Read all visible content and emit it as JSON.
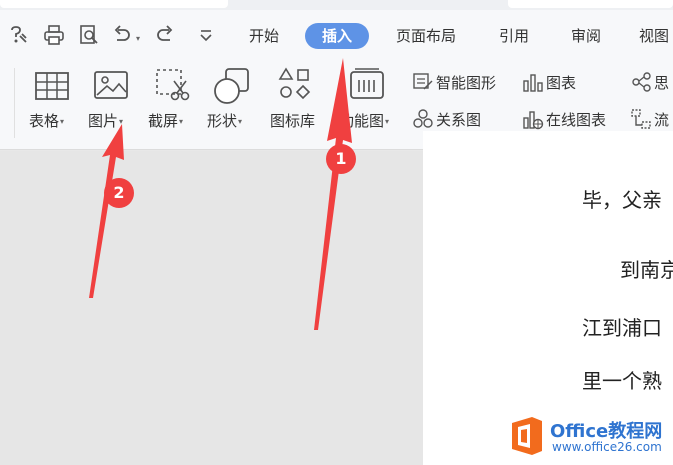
{
  "quick_access": {
    "icons": [
      "format-painter-icon",
      "print-icon",
      "print-preview-icon",
      "undo-icon",
      "redo-icon",
      "customize-dropdown-icon"
    ]
  },
  "menu": {
    "tabs": [
      {
        "label": "开始",
        "active": false
      },
      {
        "label": "插入",
        "active": true
      },
      {
        "label": "页面布局",
        "active": false
      },
      {
        "label": "引用",
        "active": false
      },
      {
        "label": "审阅",
        "active": false
      },
      {
        "label": "视图",
        "active": false
      }
    ]
  },
  "ribbon": {
    "big_buttons": [
      {
        "label": "表格",
        "icon": "table-icon",
        "dropdown": true
      },
      {
        "label": "图片",
        "icon": "picture-icon",
        "dropdown": true
      },
      {
        "label": "截屏",
        "icon": "screenshot-icon",
        "dropdown": true
      },
      {
        "label": "形状",
        "icon": "shapes-icon",
        "dropdown": true
      },
      {
        "label": "图标库",
        "icon": "icon-library-icon",
        "dropdown": false
      },
      {
        "label": "功能图",
        "icon": "function-chart-icon",
        "dropdown": true
      }
    ],
    "small_buttons": [
      {
        "label": "智能图形",
        "icon": "smart-art-icon"
      },
      {
        "label": "图表",
        "icon": "chart-icon"
      },
      {
        "label": "关系图",
        "icon": "relationship-chart-icon"
      },
      {
        "label": "在线图表",
        "icon": "online-chart-icon"
      },
      {
        "label": "思",
        "icon": "mind-map-icon"
      },
      {
        "label": "流",
        "icon": "flowchart-icon"
      }
    ]
  },
  "document": {
    "lines": [
      "毕，父亲",
      "到南京",
      "江到浦口",
      "里一个熟"
    ]
  },
  "watermark": {
    "title": "Office教程网",
    "url": "www.office26.com"
  },
  "annotations": {
    "markers": [
      "1",
      "2"
    ]
  },
  "colors": {
    "active_tab": "#5e93e6",
    "annotation_red": "#f04040",
    "watermark_orange": "#f26b1d",
    "watermark_blue": "#2f74d0"
  }
}
